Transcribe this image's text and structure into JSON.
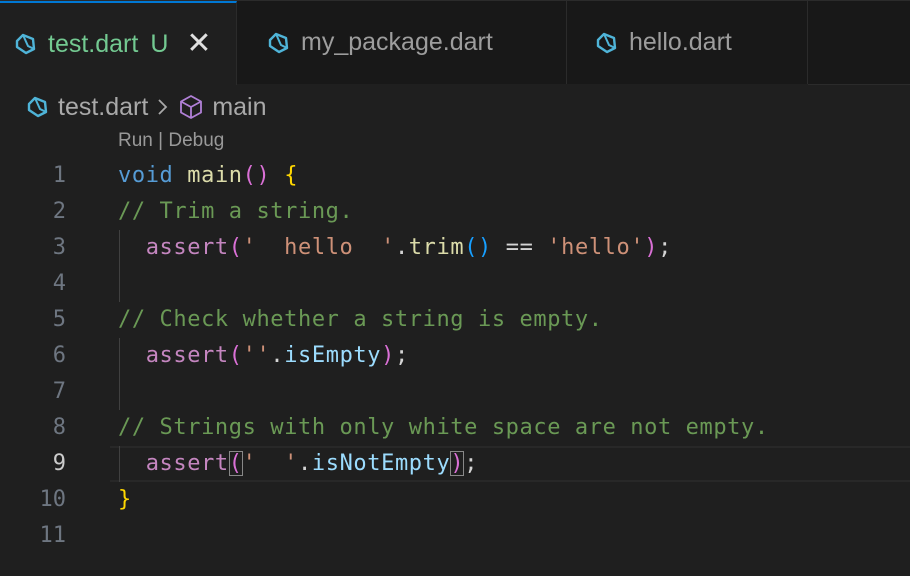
{
  "tabs": [
    {
      "label": "test.dart",
      "modified": "U",
      "close": "✕",
      "active": true
    },
    {
      "label": "my_package.dart",
      "active": false
    },
    {
      "label": "hello.dart",
      "active": false
    }
  ],
  "breadcrumb": {
    "file": "test.dart",
    "symbol": "main"
  },
  "codelens": "Run | Debug",
  "colors": {
    "accent": "#0078d4",
    "dart_icon": "#4fb4d8",
    "untracked": "#73c991",
    "symbol_icon": "#b180d7"
  },
  "lines": [
    {
      "n": "1",
      "tokens": [
        [
          "void",
          "kw"
        ],
        [
          " ",
          "op"
        ],
        [
          "main",
          "fn"
        ],
        [
          "()",
          "paren"
        ],
        [
          " ",
          "op"
        ],
        [
          "{",
          "brace"
        ]
      ]
    },
    {
      "n": "2",
      "tokens": [
        [
          "// Trim a string.",
          "com"
        ]
      ]
    },
    {
      "n": "3",
      "tokens": [
        [
          "  ",
          "op"
        ],
        [
          "assert",
          "assert"
        ],
        [
          "(",
          "paren"
        ],
        [
          "'  hello  '",
          "str"
        ],
        [
          ".",
          "op"
        ],
        [
          "trim",
          "fn"
        ],
        [
          "()",
          "paren2"
        ],
        [
          " == ",
          "op"
        ],
        [
          "'hello'",
          "str"
        ],
        [
          ")",
          "paren"
        ],
        [
          ";",
          "op"
        ]
      ]
    },
    {
      "n": "4",
      "tokens": []
    },
    {
      "n": "5",
      "tokens": [
        [
          "// Check whether a string is empty.",
          "com"
        ]
      ]
    },
    {
      "n": "6",
      "tokens": [
        [
          "  ",
          "op"
        ],
        [
          "assert",
          "assert"
        ],
        [
          "(",
          "paren"
        ],
        [
          "''",
          "str"
        ],
        [
          ".",
          "op"
        ],
        [
          "isEmpty",
          "prop"
        ],
        [
          ")",
          "paren"
        ],
        [
          ";",
          "op"
        ]
      ]
    },
    {
      "n": "7",
      "tokens": []
    },
    {
      "n": "8",
      "tokens": [
        [
          "// Strings with only white space are not empty.",
          "com"
        ]
      ]
    },
    {
      "n": "9",
      "active": true,
      "tokens": [
        [
          "  ",
          "op"
        ],
        [
          "assert",
          "assert"
        ],
        [
          "(",
          "paren match"
        ],
        [
          "'  '",
          "str"
        ],
        [
          ".",
          "op"
        ],
        [
          "isNotEmpty",
          "prop"
        ],
        [
          ")",
          "paren match"
        ],
        [
          ";",
          "op"
        ]
      ]
    },
    {
      "n": "10",
      "tokens": [
        [
          "}",
          "brace"
        ]
      ]
    },
    {
      "n": "11",
      "tokens": []
    }
  ]
}
